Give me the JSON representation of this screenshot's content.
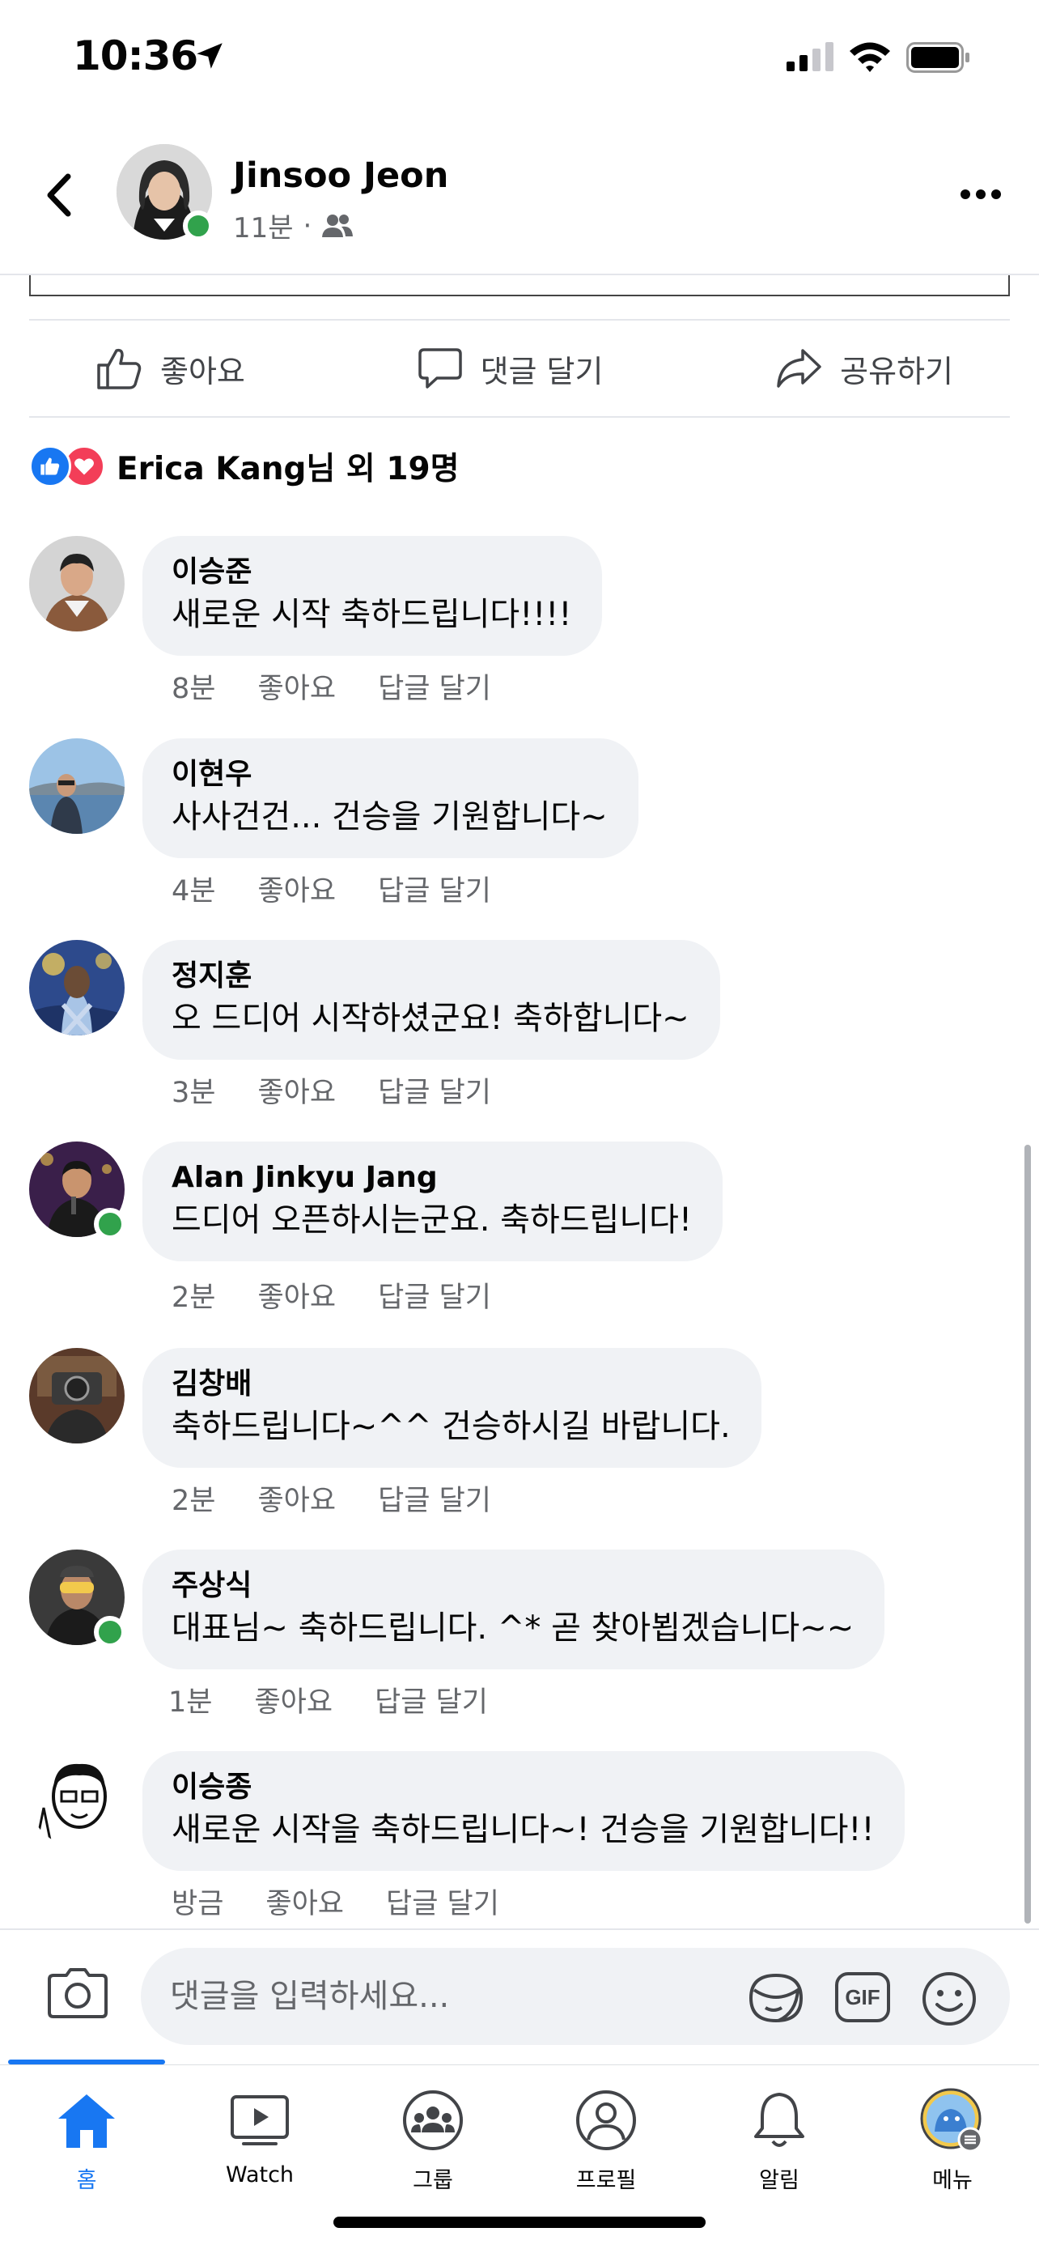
{
  "status_bar": {
    "time": "10:36"
  },
  "header": {
    "name": "Jinsoo Jeon",
    "time_ago": "11분",
    "separator": "·"
  },
  "actions": {
    "like": "좋아요",
    "comment": "댓글 달기",
    "share": "공유하기"
  },
  "reactions": {
    "summary": "Erica Kang님 외 19명"
  },
  "comments": [
    {
      "name": "이승준",
      "text": "새로운 시작 축하드립니다!!!!",
      "time": "8분",
      "like": "좋아요",
      "reply": "답글 달기"
    },
    {
      "name": "이현우",
      "text": "사사건건... 건승을 기원합니다~",
      "time": "4분",
      "like": "좋아요",
      "reply": "답글 달기"
    },
    {
      "name": "정지훈",
      "text": "오 드디어 시작하셨군요! 축하합니다~",
      "time": "3분",
      "like": "좋아요",
      "reply": "답글 달기"
    },
    {
      "name": "Alan Jinkyu Jang",
      "text": "드디어 오픈하시는군요. 축하드립니다!",
      "time": "2분",
      "like": "좋아요",
      "reply": "답글 달기"
    },
    {
      "name": "김창배",
      "text": "축하드립니다~^^ 건승하시길 바랍니다.",
      "time": "2분",
      "like": "좋아요",
      "reply": "답글 달기"
    },
    {
      "name": "주상식",
      "text": "대표님~ 축하드립니다. ^* 곧 찾아뵙겠습니다~~",
      "time": "1분",
      "like": "좋아요",
      "reply": "답글 달기"
    },
    {
      "name": "이승종",
      "text": "새로운 시작을 축하드립니다~! 건승을 기원합니다!!",
      "time": "방금",
      "like": "좋아요",
      "reply": "답글 달기"
    }
  ],
  "composer": {
    "placeholder": "댓글을 입력하세요...",
    "gif_label": "GIF"
  },
  "tabs": [
    {
      "label": "홈",
      "icon": "home-icon"
    },
    {
      "label": "Watch",
      "icon": "watch-icon"
    },
    {
      "label": "그룹",
      "icon": "groups-icon"
    },
    {
      "label": "프로필",
      "icon": "profile-icon"
    },
    {
      "label": "알림",
      "icon": "bell-icon"
    },
    {
      "label": "메뉴",
      "icon": "menu-avatar-icon"
    }
  ],
  "colors": {
    "accent": "#1877f2",
    "online": "#31a24c",
    "love": "#f33e58",
    "bubble": "#f0f2f5",
    "muted": "#65676b"
  }
}
